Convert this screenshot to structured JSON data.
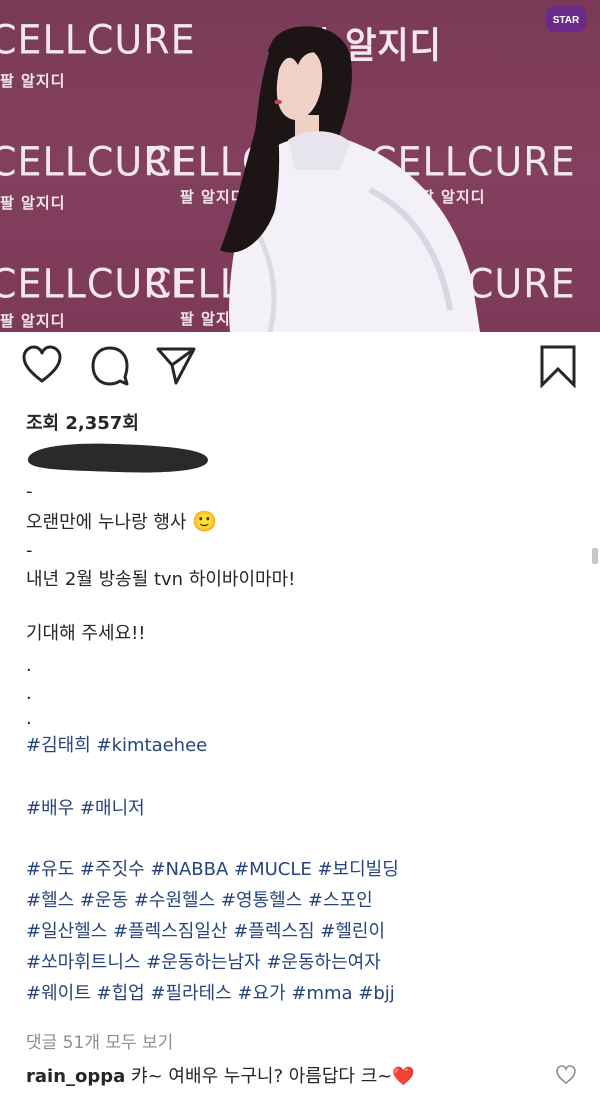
{
  "photo": {
    "backdrop_big_text": "CELLCURE",
    "backdrop_small_text": "팔 알지디",
    "backdrop_top_text": "팔 알지디",
    "badge_text": "STAR",
    "background_color": "#7f3c5a"
  },
  "actions": {
    "like_icon": "heart-icon",
    "comment_icon": "comment-bubble-icon",
    "share_icon": "paper-plane-icon",
    "save_icon": "bookmark-icon"
  },
  "post": {
    "views": "조회 2,357회",
    "caption_lines": [
      "-",
      "오랜만에 누나랑 행사",
      "-",
      "내년 2월  방송될 tvn 하이바이마마!",
      "",
      "기대해 주세요!!",
      ".",
      ".",
      "."
    ],
    "emoji": "🙂",
    "hashtags_row1": "#김태희 #kimtaehee",
    "hashtags_row2": "#배우 #매니저",
    "hashtags_rows": [
      "#유도 #주짓수 #NABBA #MUCLE #보디빌딩",
      "#헬스 #운동 #수원헬스 #영통헬스 #스포인",
      "#일산헬스 #플렉스짐일산 #플렉스짐 #헬린이",
      "#쏘마휘트니스 #운동하는남자 #운동하는여자",
      "#웨이트 #힙업 #필라테스 #요가 #mma #bjj"
    ],
    "view_comments": "댓글 51개 모두 보기",
    "comment": {
      "user": "rain_oppa",
      "text": "캬~ 여배우 누구니? 아름답다 크~❤️"
    }
  },
  "colors": {
    "hashtag": "#27457d",
    "muted": "#8e8e8e",
    "text": "#262626"
  }
}
